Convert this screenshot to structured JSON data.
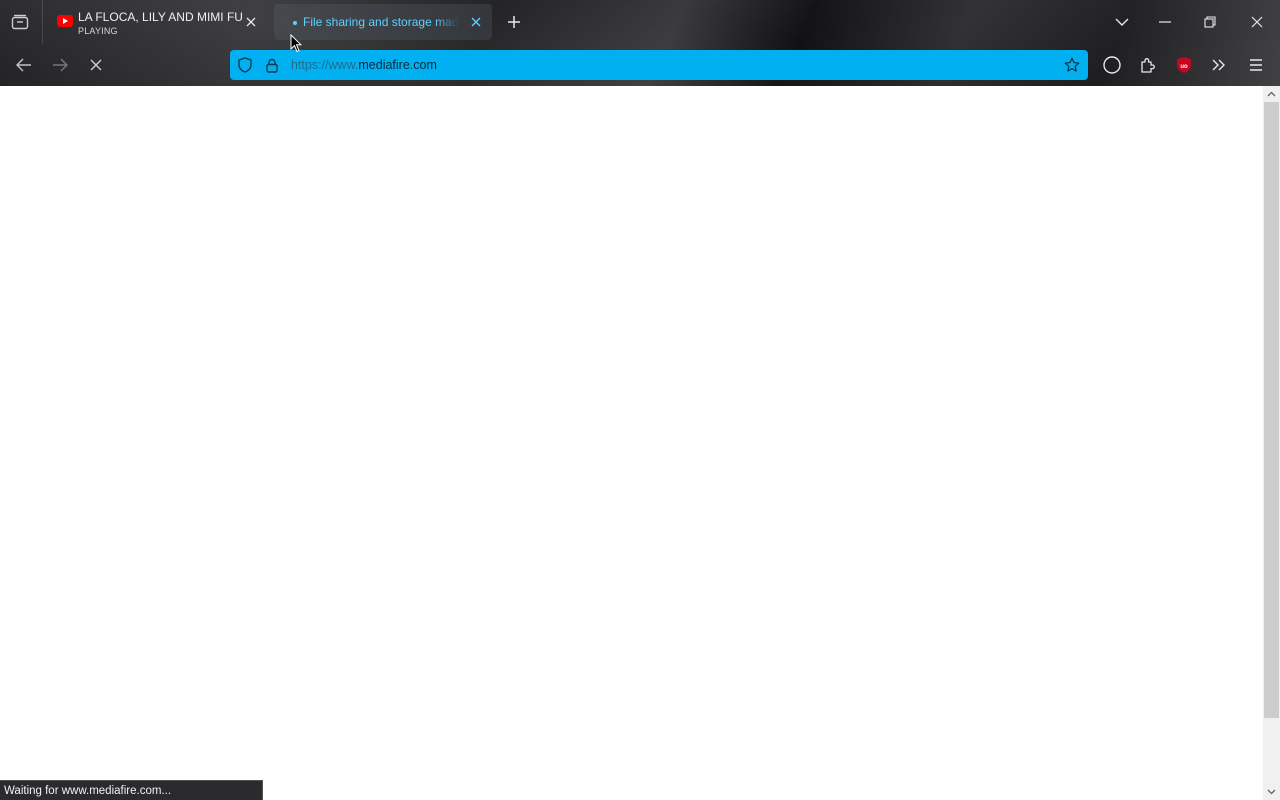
{
  "tabs": [
    {
      "title": "LA FLOCA, LILY AND MIMI FUNNY",
      "subtitle": "PLAYING",
      "icon": "youtube-icon"
    },
    {
      "title": "File sharing and storage made simple",
      "icon": "loading-dot-icon",
      "active": true
    }
  ],
  "urlbar": {
    "url_prefix": "https://www.",
    "url_domain": "mediafire.com"
  },
  "extensions": {
    "ublock_badge": "2"
  },
  "status_bar": {
    "text": "Waiting for www.mediafire.com..."
  },
  "colors": {
    "accent": "#00b0f0",
    "active_tab_text": "#5fd0ff",
    "ublock": "#c4001a"
  }
}
